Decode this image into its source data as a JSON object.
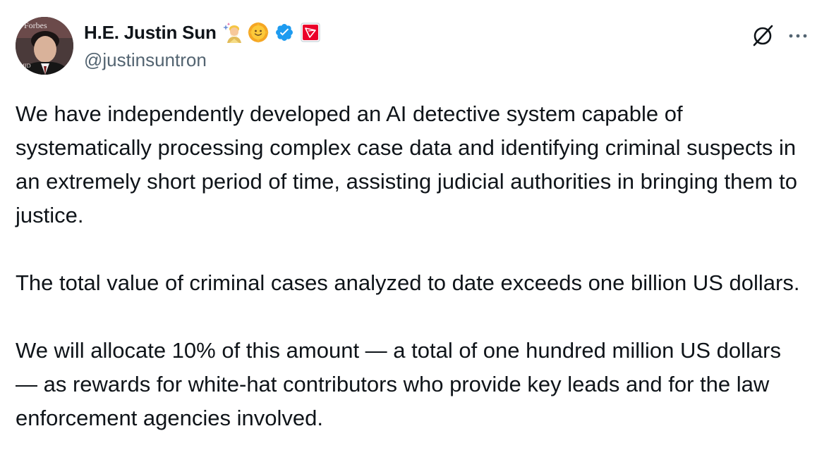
{
  "author": {
    "display_name": "H.E. Justin Sun",
    "handle": "@justinsuntron",
    "avatar_text": "Forbes",
    "badges": [
      "mage-emoji",
      "sun-emoji",
      "verified-icon",
      "tron-icon"
    ]
  },
  "actions": {
    "grok_icon": "grok-icon",
    "more_icon": "more-icon"
  },
  "post": {
    "paragraphs": [
      "We have independently developed an AI detective system capable of systematically processing complex case data and identifying criminal suspects in an extremely short period of time, assisting judicial authorities in bringing them to justice.",
      "The total value of criminal cases analyzed to date exceeds one billion US dollars.",
      "We will allocate 10% of this amount — a total of one hundred million US dollars — as rewards for white-hat contributors who provide key leads and for the law enforcement agencies involved."
    ]
  },
  "colors": {
    "text": "#0f1419",
    "secondary": "#536471",
    "verified": "#1d9bf0",
    "tron": "#eb0029"
  }
}
